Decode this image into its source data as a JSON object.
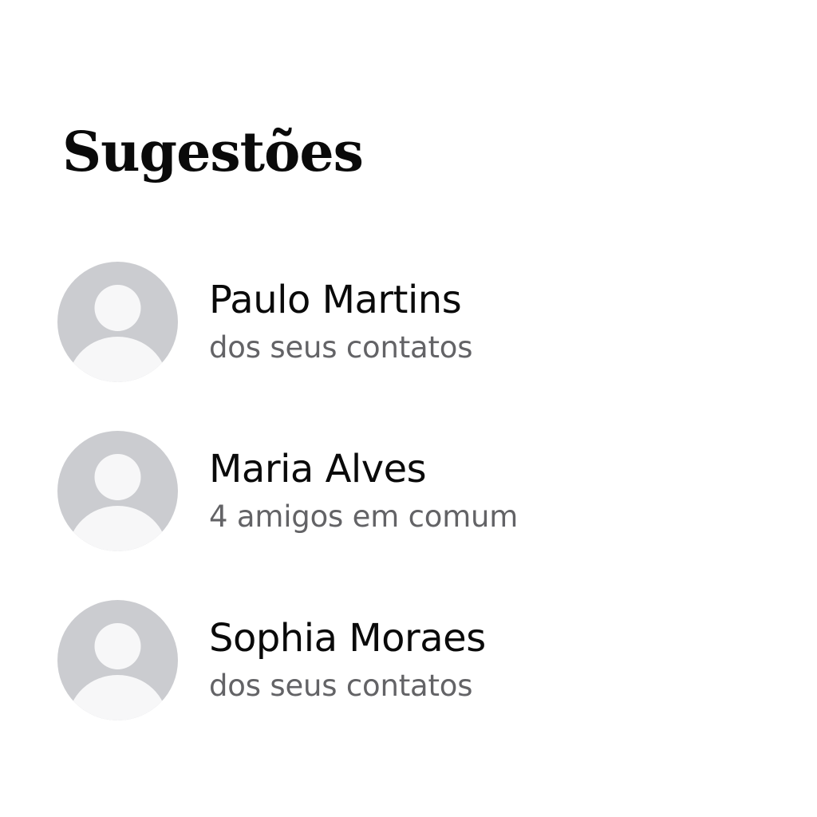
{
  "header": {
    "title": "Sugestões"
  },
  "suggestions": [
    {
      "name": "Paulo Martins",
      "subtitle": "dos seus contatos",
      "avatar_icon": "person-placeholder-icon"
    },
    {
      "name": "Maria Alves",
      "subtitle": "4 amigos em comum",
      "avatar_icon": "person-placeholder-icon"
    },
    {
      "name": "Sophia Moraes",
      "subtitle": "dos seus contatos",
      "avatar_icon": "person-placeholder-icon"
    }
  ],
  "colors": {
    "background": "#ffffff",
    "title_text": "#0a0a0a",
    "name_text": "#0a0a0a",
    "subtitle_text": "#636366",
    "avatar_background": "#cbccd0",
    "avatar_figure": "#f7f7f8"
  }
}
